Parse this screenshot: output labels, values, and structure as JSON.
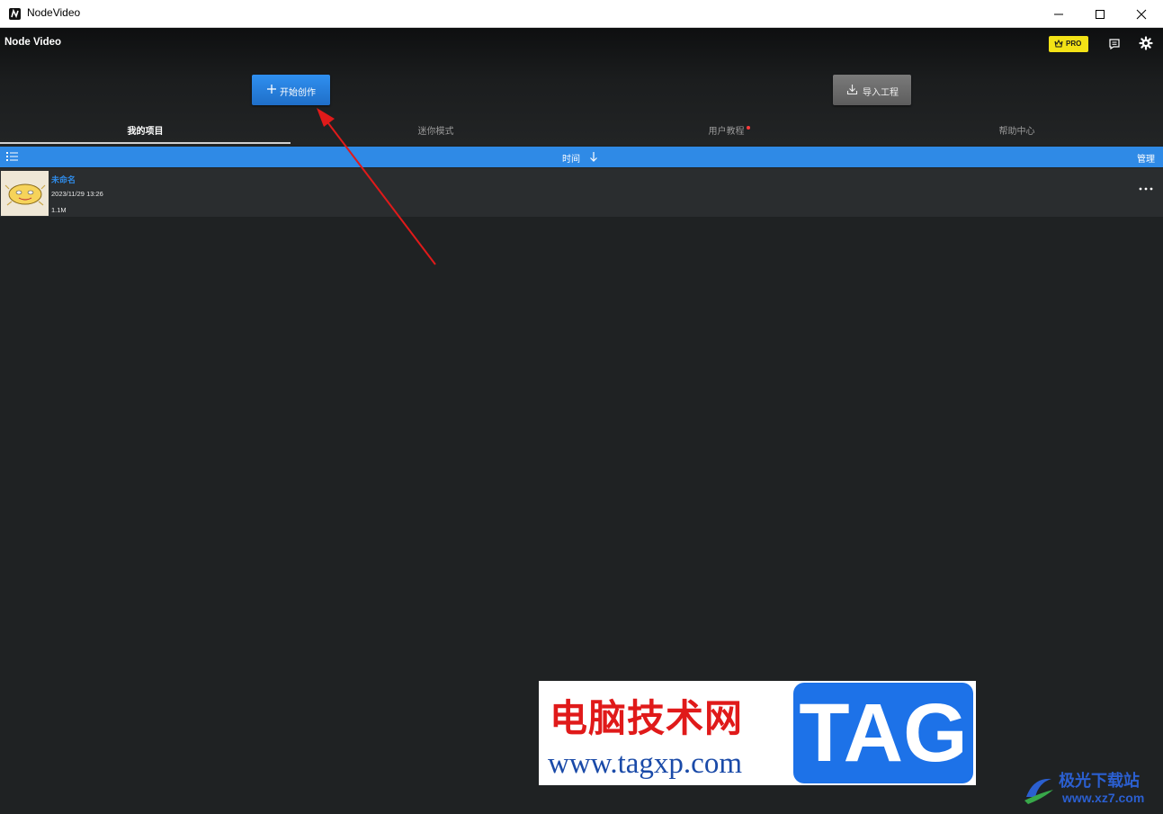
{
  "window": {
    "title": "NodeVideo"
  },
  "header": {
    "brand": "Node Video",
    "pro_badge": "PRO",
    "create_button": "开始创作",
    "import_button": "导入工程"
  },
  "tabs": [
    {
      "label": "我的项目",
      "active": true
    },
    {
      "label": "迷你模式",
      "active": false
    },
    {
      "label": "用户教程",
      "active": false,
      "notification_dot": true
    },
    {
      "label": "帮助中心",
      "active": false
    }
  ],
  "sortbar": {
    "sort_label": "时间",
    "manage_label": "管理"
  },
  "projects": [
    {
      "name": "未命名",
      "date": "2023/11/29 13:26",
      "size": "1.1M"
    }
  ],
  "watermark": {
    "cn_text": "电脑技术网",
    "tag_text": "TAG",
    "url": "www.tagxp.com",
    "site2_cn": "极光下载站",
    "site2_url": "www.xz7.com"
  },
  "colors": {
    "accent": "#2f8ae6",
    "background": "#1f2223",
    "pro_badge": "#f3e216",
    "annotation_arrow": "#e01a1a"
  }
}
